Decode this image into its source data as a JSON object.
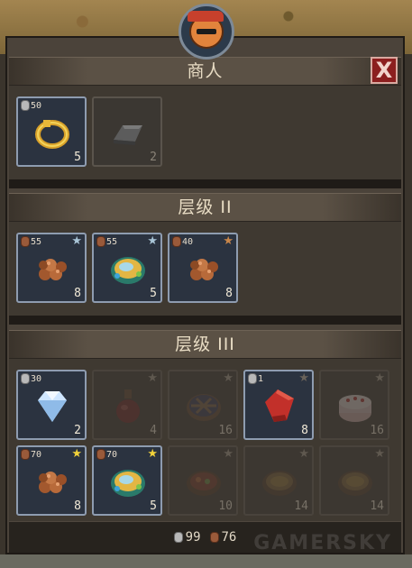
{
  "window": {
    "close_label": "X"
  },
  "sections": [
    {
      "title": "商人",
      "items": [
        {
          "icon": "gold-ring-icon",
          "price": "50",
          "price_type": "silver",
          "qty": "5",
          "state": "active",
          "star": ""
        },
        {
          "icon": "iron-ingot-icon",
          "price": "",
          "price_type": "",
          "qty": "2",
          "state": "plain",
          "star": ""
        }
      ]
    },
    {
      "title": "层级 II",
      "items": [
        {
          "icon": "ore-pile-icon",
          "price": "55",
          "price_type": "copper",
          "qty": "8",
          "state": "active",
          "star": "silver"
        },
        {
          "icon": "food-plate-icon",
          "price": "55",
          "price_type": "copper",
          "qty": "5",
          "state": "active",
          "star": "silver"
        },
        {
          "icon": "ore-pile-icon",
          "price": "40",
          "price_type": "copper",
          "qty": "8",
          "state": "active",
          "star": "bronze"
        }
      ]
    },
    {
      "title": "层级 III",
      "items": [
        {
          "icon": "diamond-icon",
          "price": "30",
          "price_type": "silver",
          "qty": "2",
          "state": "active",
          "star": ""
        },
        {
          "icon": "potion-bottle-icon",
          "price": "",
          "price_type": "",
          "qty": "4",
          "state": "dim",
          "star": "dim"
        },
        {
          "icon": "pie-icon",
          "price": "",
          "price_type": "",
          "qty": "16",
          "state": "dim",
          "star": "dim"
        },
        {
          "icon": "red-cloth-icon",
          "price": "1",
          "price_type": "silver",
          "qty": "8",
          "state": "active",
          "star": "dim"
        },
        {
          "icon": "cake-icon",
          "price": "",
          "price_type": "",
          "qty": "16",
          "state": "dim",
          "star": "dim"
        },
        {
          "icon": "ore-pile-icon",
          "price": "70",
          "price_type": "copper",
          "qty": "8",
          "state": "active",
          "star": "gold"
        },
        {
          "icon": "food-plate-icon",
          "price": "70",
          "price_type": "copper",
          "qty": "5",
          "state": "active",
          "star": "gold"
        },
        {
          "icon": "stew-bowl-icon",
          "price": "",
          "price_type": "",
          "qty": "10",
          "state": "dim",
          "star": "dim"
        },
        {
          "icon": "soup-bowl-icon",
          "price": "",
          "price_type": "",
          "qty": "14",
          "state": "dim",
          "star": "dim"
        },
        {
          "icon": "soup-bowl-icon",
          "price": "",
          "price_type": "",
          "qty": "14",
          "state": "dim",
          "star": "dim"
        }
      ]
    }
  ],
  "footer": {
    "silver": "99",
    "copper": "76"
  },
  "watermark": "GAMERSKY",
  "colors": {
    "star_silver": "#a8c4d6",
    "star_bronze": "#c8864a",
    "star_gold": "#f2d23a",
    "star_dim": "#6a635a"
  }
}
